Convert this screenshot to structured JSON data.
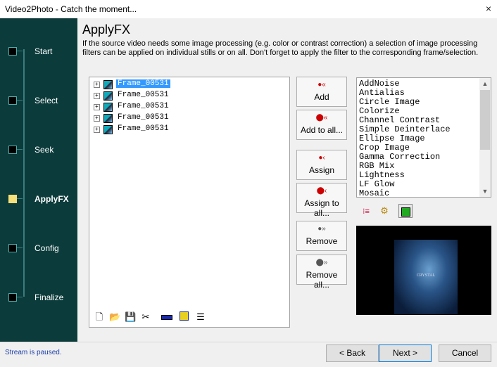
{
  "window": {
    "title": "Video2Photo - Catch the moment...",
    "close_glyph": "×"
  },
  "sidebar": {
    "steps": [
      {
        "label": "Start",
        "active": false
      },
      {
        "label": "Select",
        "active": false
      },
      {
        "label": "Seek",
        "active": false
      },
      {
        "label": "ApplyFX",
        "active": true
      },
      {
        "label": "Config",
        "active": false
      },
      {
        "label": "Finalize",
        "active": false
      }
    ]
  },
  "main": {
    "title": "ApplyFX",
    "description": "If the source video needs some image processing (e.g. color or contrast correction) a selection of image processing filters can be applied on individual stills or on all. Don't forget to apply the filter to the corresponding frame/selection."
  },
  "frames": [
    {
      "label": "Frame_00531",
      "selected": true
    },
    {
      "label": "Frame_00531",
      "selected": false
    },
    {
      "label": "Frame_00531",
      "selected": false
    },
    {
      "label": "Frame_00531",
      "selected": false
    },
    {
      "label": "Frame_00531",
      "selected": false
    }
  ],
  "frames_toolbar": {
    "icons": [
      "new-file-icon",
      "open-folder-icon",
      "save-icon",
      "cut-icon",
      "bar-icon",
      "grid-icon",
      "list-icon"
    ]
  },
  "buttons": {
    "add": "Add",
    "add_all": "Add to all...",
    "assign": "Assign",
    "assign_all": "Assign to all...",
    "remove": "Remove",
    "remove_all": "Remove all..."
  },
  "filters": [
    "AddNoise",
    "Antialias",
    "Circle Image",
    "Colorize",
    "Channel Contrast",
    "Simple Deinterlace",
    "Ellipse Image",
    "Crop Image",
    "Gamma Correction",
    "RGB Mix",
    "Lightness",
    "LF Glow",
    "Mosaic"
  ],
  "filter_tools": [
    "list-view-icon",
    "settings-icon",
    "frame-view-icon"
  ],
  "preview": {
    "caption": "CRYSTAL",
    "colors": {
      "background": "#000000",
      "accent": "#2a5588"
    }
  },
  "status": {
    "text": "Stream is paused."
  },
  "nav": {
    "back": "< Back",
    "next": "Next >",
    "cancel": "Cancel"
  },
  "colors": {
    "sidebar": "#0c3b3b",
    "active_step": "#f5e07a",
    "selection": "#3399ff",
    "status_text": "#1c3fa8"
  }
}
